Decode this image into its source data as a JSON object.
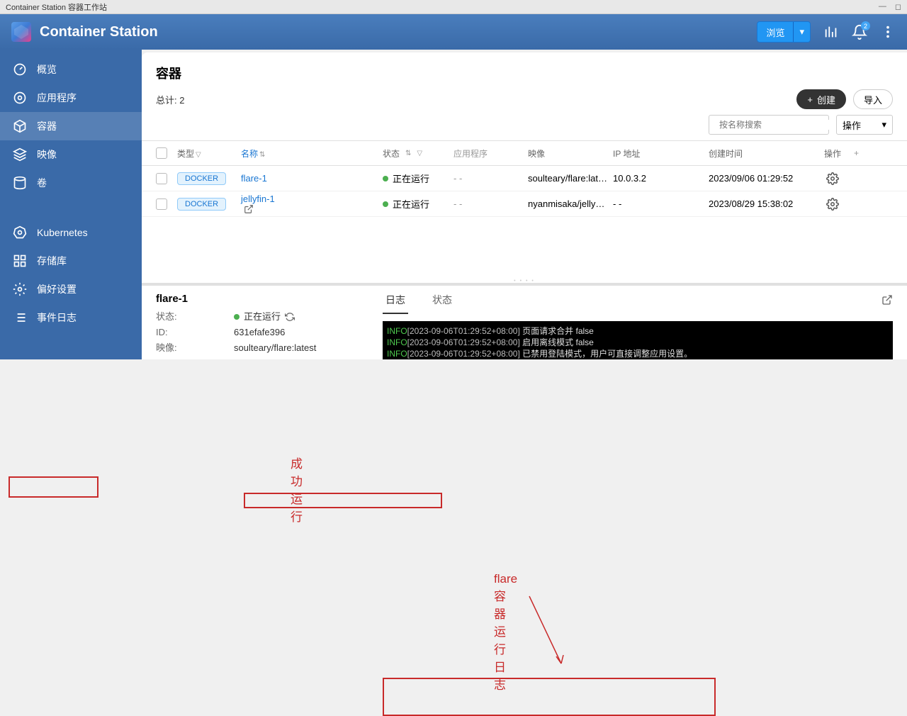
{
  "titlebar": {
    "title": "Container Station 容器工作站"
  },
  "header": {
    "app_name": "Container Station",
    "browse_label": "浏览",
    "notif_count": "2"
  },
  "sidebar": {
    "items": [
      {
        "key": "overview",
        "label": "概览"
      },
      {
        "key": "apps",
        "label": "应用程序"
      },
      {
        "key": "containers",
        "label": "容器"
      },
      {
        "key": "images",
        "label": "映像"
      },
      {
        "key": "volumes",
        "label": "卷"
      },
      {
        "key": "kubernetes",
        "label": "Kubernetes"
      },
      {
        "key": "repositories",
        "label": "存储库"
      },
      {
        "key": "preferences",
        "label": "偏好设置"
      },
      {
        "key": "eventlog",
        "label": "事件日志"
      }
    ]
  },
  "main": {
    "page_title": "容器",
    "total_label": "总计: 2",
    "create_label": "创建",
    "import_label": "导入",
    "search_placeholder": "按名称搜索",
    "action_label": "操作",
    "columns": {
      "type": "类型",
      "name": "名称",
      "status": "状态",
      "app": "应用程序",
      "image": "映像",
      "ip": "IP 地址",
      "created": "创建时间",
      "action": "操作"
    },
    "rows": [
      {
        "type": "DOCKER",
        "name": "flare-1",
        "status": "正在运行",
        "app": "- -",
        "image": "soulteary/flare:lat…",
        "ip": "10.0.3.2",
        "created": "2023/09/06 01:29:52",
        "external": false
      },
      {
        "type": "DOCKER",
        "name": "jellyfin-1",
        "status": "正在运行",
        "app": "- -",
        "image": "nyanmisaka/jelly…",
        "ip": "- -",
        "created": "2023/08/29 15:38:02",
        "external": true
      }
    ]
  },
  "detail": {
    "name": "flare-1",
    "labels": {
      "status": "状态:",
      "id": "ID:",
      "image": "映像:"
    },
    "status": "正在运行",
    "id": "631efafe396",
    "image": "soulteary/flare:latest",
    "tabs": {
      "log": "日志",
      "state": "状态"
    },
    "logs": [
      {
        "level": "INFO",
        "time": "[2023-09-06T01:29:52+08:00]",
        "msg": "页面请求合并  false"
      },
      {
        "level": "INFO",
        "time": "[2023-09-06T01:29:52+08:00]",
        "msg": "启用离线模式  false"
      },
      {
        "level": "INFO",
        "time": "[2023-09-06T01:29:52+08:00]",
        "msg": "已禁用登陆模式，用户可直接调整应用设置。"
      }
    ]
  },
  "annotations": {
    "success": "成功运行",
    "log_title": "flare容器运行日志"
  }
}
